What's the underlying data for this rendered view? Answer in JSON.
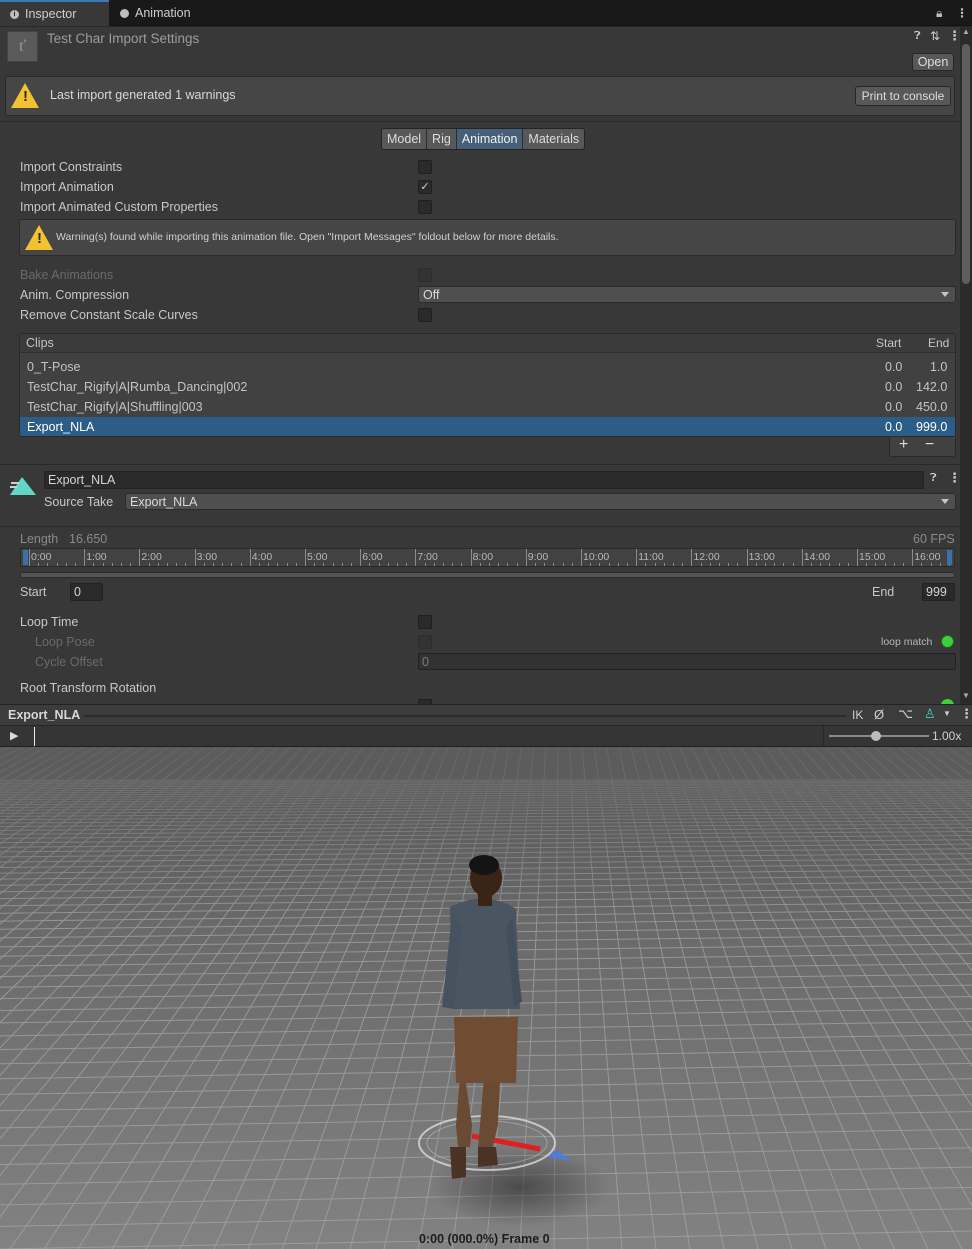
{
  "tabs": [
    {
      "label": "Inspector",
      "active": true
    },
    {
      "label": "Animation",
      "active": false
    }
  ],
  "header": {
    "title": "Test Char Import Settings",
    "open_label": "Open"
  },
  "import_warning": {
    "text": "Last import generated 1 warnings",
    "button": "Print to console"
  },
  "mode_tabs": [
    {
      "label": "Model",
      "active": false
    },
    {
      "label": "Rig",
      "active": false
    },
    {
      "label": "Animation",
      "active": true
    },
    {
      "label": "Materials",
      "active": false
    }
  ],
  "settings": {
    "import_constraints": {
      "label": "Import Constraints",
      "checked": false
    },
    "import_animation": {
      "label": "Import Animation",
      "checked": true
    },
    "import_custom_props": {
      "label": "Import Animated Custom Properties",
      "checked": false
    },
    "warning_msg": "Warning(s) found while importing this animation file. Open \"Import Messages\" foldout below for more details.",
    "bake_animations": {
      "label": "Bake Animations",
      "checked": false,
      "disabled": true
    },
    "anim_compression": {
      "label": "Anim. Compression",
      "value": "Off"
    },
    "remove_scale_curves": {
      "label": "Remove Constant Scale Curves",
      "checked": false
    }
  },
  "clips": {
    "header": {
      "name": "Clips",
      "start": "Start",
      "end": "End"
    },
    "rows": [
      {
        "name": "0_T-Pose",
        "start": "0.0",
        "end": "1.0",
        "selected": false
      },
      {
        "name": "TestChar_Rigify|A|Rumba_Dancing|002",
        "start": "0.0",
        "end": "142.0",
        "selected": false
      },
      {
        "name": "TestChar_Rigify|A|Shuffling|003",
        "start": "0.0",
        "end": "450.0",
        "selected": false
      },
      {
        "name": "Export_NLA",
        "start": "0.0",
        "end": "999.0",
        "selected": true
      }
    ],
    "add_label": "+",
    "remove_label": "−"
  },
  "clip_detail": {
    "name": "Export_NLA",
    "source_take_label": "Source Take",
    "source_take_value": "Export_NLA",
    "length_label": "Length",
    "length_value": "16.650",
    "fps": "60 FPS",
    "timeline_labels": [
      "0:00",
      "1:00",
      "2:00",
      "3:00",
      "4:00",
      "5:00",
      "6:00",
      "7:00",
      "8:00",
      "9:00",
      "10:00",
      "11:00",
      "12:00",
      "13:00",
      "14:00",
      "15:00",
      "16:00"
    ],
    "start_label": "Start",
    "start_value": "0",
    "end_label": "End",
    "end_value": "999",
    "loop_time": {
      "label": "Loop Time",
      "checked": false
    },
    "loop_pose": {
      "label": "Loop Pose",
      "checked": false
    },
    "loop_match": "loop match",
    "cycle_offset": {
      "label": "Cycle Offset",
      "value": "0"
    },
    "root_transform_rotation": "Root Transform Rotation"
  },
  "preview": {
    "clip_name": "Export_NLA",
    "ik_label": "IK",
    "speed": "1.00x",
    "status": "0:00 (000.0%) Frame 0"
  },
  "colors": {
    "accent": "#3a79bb",
    "selection": "#2c5d87",
    "warning": "#f2c230",
    "loop_match": "#3ecf3e"
  }
}
